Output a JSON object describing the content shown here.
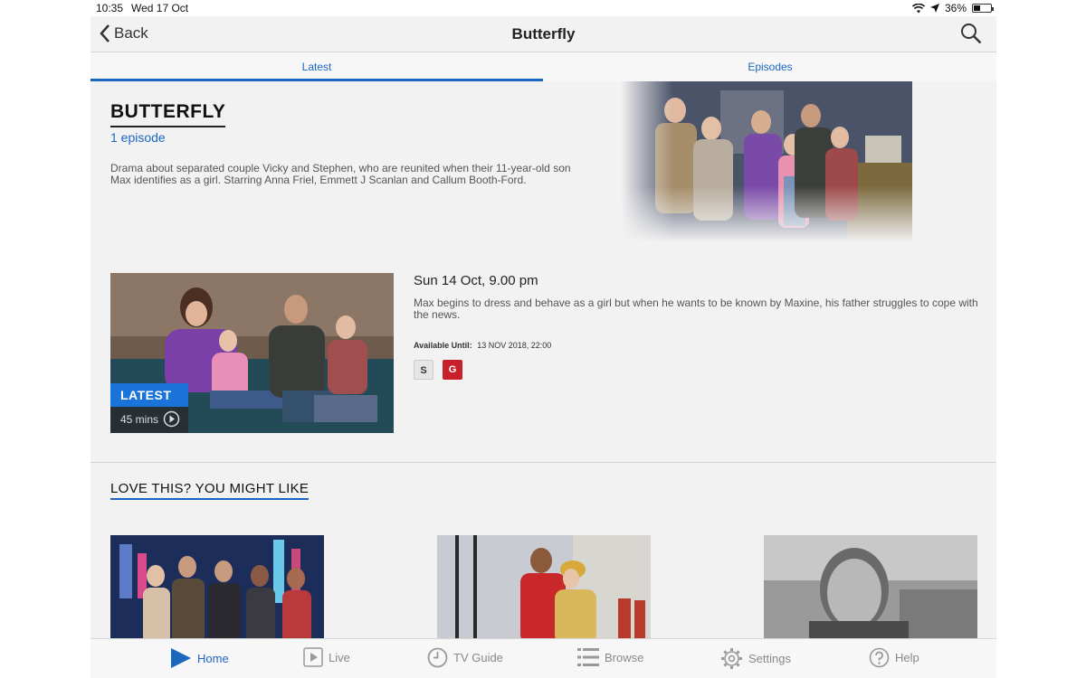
{
  "status_bar": {
    "time": "10:35",
    "date": "Wed 17 Oct",
    "battery": "36%",
    "battery_level": 0.36
  },
  "navbar": {
    "back_label": "Back",
    "title": "Butterfly"
  },
  "tabs": [
    {
      "label": "Latest",
      "active": true
    },
    {
      "label": "Episodes",
      "active": false
    }
  ],
  "show": {
    "title": "BUTTERFLY",
    "episode_count": "1 episode",
    "description": "Drama about separated couple Vicky and Stephen, who are reunited when their 11-year-old son Max identifies as a girl. Starring Anna Friel, Emmett J Scanlan and Callum Booth-Ford."
  },
  "episode": {
    "badge": "LATEST",
    "duration": "45 mins",
    "date": "Sun 14 Oct, 9.00 pm",
    "description": "Max begins to dress and behave as a girl but when he wants to be known by Maxine, his father struggles to cope with the news.",
    "available_label": "Available Until:",
    "available_value": "13 NOV 2018, 22:00",
    "chips": [
      "S",
      "G"
    ]
  },
  "recommendations": {
    "title": "LOVE THIS? YOU MIGHT LIKE"
  },
  "tabbar": [
    {
      "label": "Home",
      "icon": "play-triangle-icon",
      "active": true
    },
    {
      "label": "Live",
      "icon": "live-tv-icon",
      "active": false
    },
    {
      "label": "TV Guide",
      "icon": "clock-icon",
      "active": false
    },
    {
      "label": "Browse",
      "icon": "list-icon",
      "active": false
    },
    {
      "label": "Settings",
      "icon": "gear-icon",
      "active": false
    },
    {
      "label": "Help",
      "icon": "help-icon",
      "active": false
    }
  ],
  "colors": {
    "accent": "#1a67c0",
    "badge_blue": "#1a73d9",
    "guidance_red": "#c8202a",
    "background": "#f2f2f2"
  }
}
